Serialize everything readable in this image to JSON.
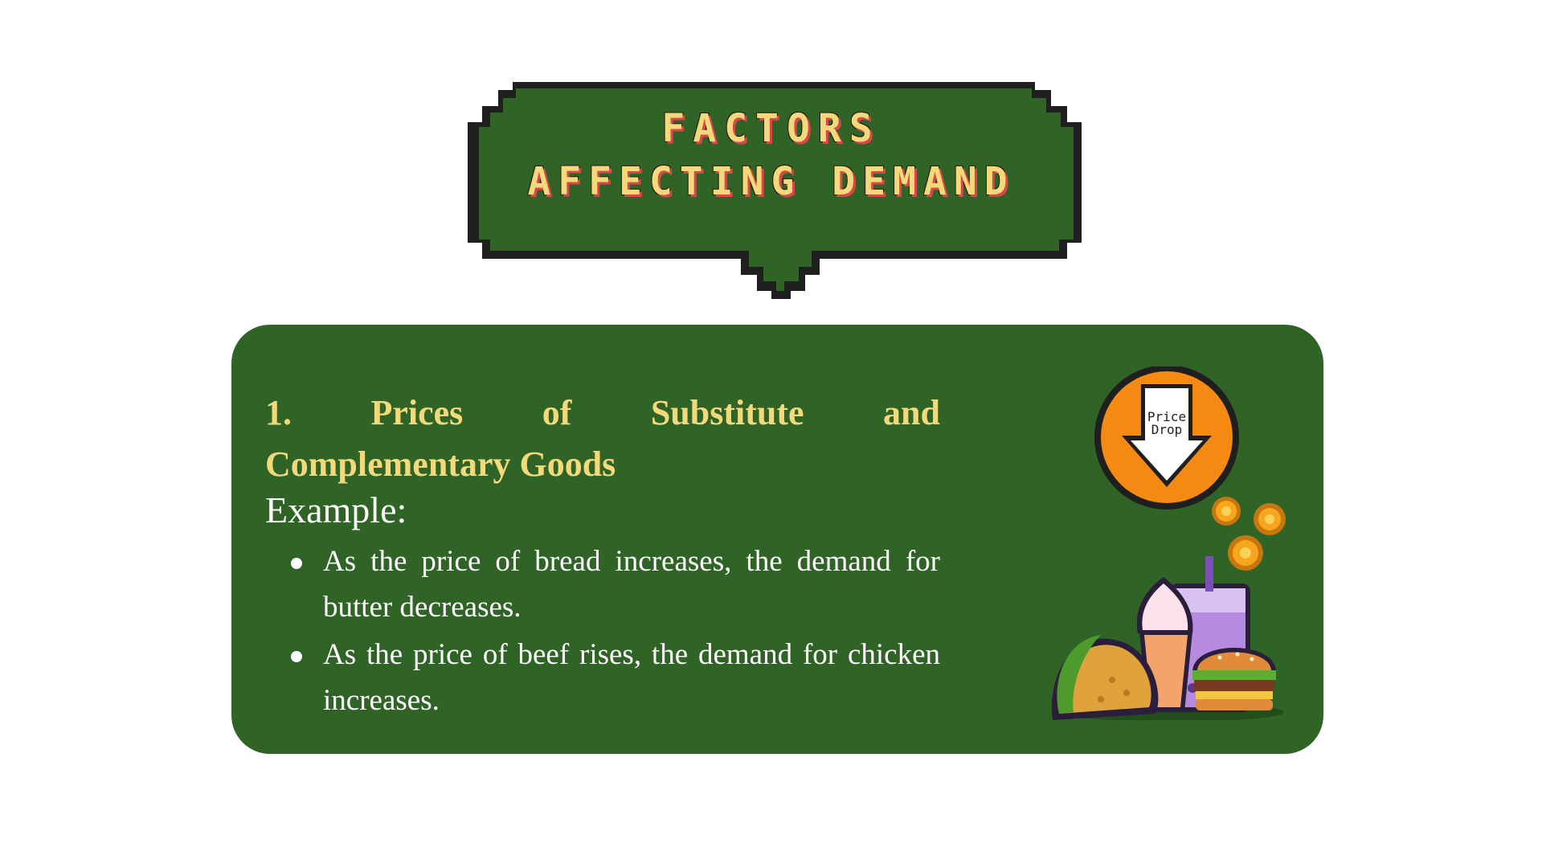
{
  "title": {
    "line1": "FACTORS",
    "line2": "AFFECTING DEMAND"
  },
  "card": {
    "heading_row1": [
      "1.",
      "Prices",
      "of",
      "Substitute",
      "and"
    ],
    "heading_row2": "Complementary Goods",
    "example_label": "Example:",
    "bullets": [
      "As the price of bread increases, the demand for butter decreases.",
      "As the price of beef rises, the demand for chicken increases."
    ]
  },
  "illustration": {
    "badge_line1": "Price",
    "badge_line2": "Drop",
    "badge_icon": "down-arrow-icon",
    "food_icons": [
      "coin-icon",
      "taco-icon",
      "ice-cream-icon",
      "bubble-tea-icon",
      "burger-icon"
    ]
  },
  "colors": {
    "green": "#2f6426",
    "yellow": "#f3d97a",
    "orange": "#f58a12",
    "outline": "#1f1f1f"
  }
}
